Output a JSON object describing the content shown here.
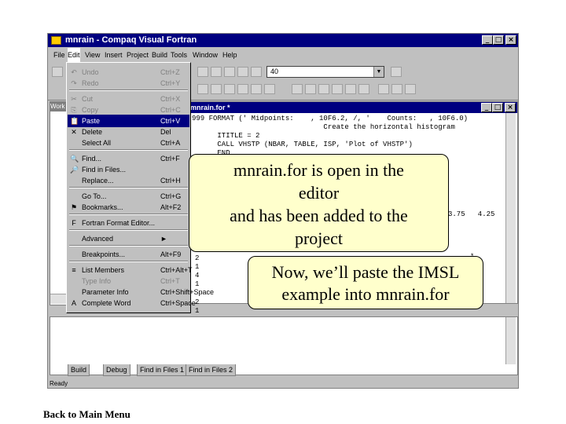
{
  "window": {
    "title": "mnrain - Compaq Visual Fortran",
    "controls": [
      "_",
      "□",
      "×"
    ]
  },
  "menubar": [
    "File",
    "Edit",
    "View",
    "Insert",
    "Project",
    "Build",
    "Tools",
    "Window",
    "Help"
  ],
  "toolbar": {
    "combo_value": "40"
  },
  "left_pane": {
    "tab_label": "Work"
  },
  "editor": {
    "title": "mnrain.for *",
    "code_lines": [
      "999 FORMAT (' Midpoints:    , 10F6.2, /, '    Counts:   , 10F6.0)",
      "                               Create the horizontal histogram",
      "      ITITLE = 2",
      "      CALL VHSTP (NBAR, TABLE, ISP, 'Plot of VHSTP')",
      "      END"
    ],
    "right_values": "3.75   4.25",
    "stars": [
      "*",
      "*",
      "*",
      "*"
    ],
    "left_digits": [
      "2",
      "1",
      "4",
      "1",
      "2",
      "1",
      "1"
    ]
  },
  "edit_menu": {
    "items": [
      {
        "icon": "↶",
        "label": "Undo",
        "shortcut": "Ctrl+Z",
        "state": "disabled"
      },
      {
        "icon": "↷",
        "label": "Redo",
        "shortcut": "Ctrl+Y",
        "state": "disabled"
      },
      {
        "sep": true
      },
      {
        "icon": "✂",
        "label": "Cut",
        "shortcut": "Ctrl+X",
        "state": "disabled"
      },
      {
        "icon": "⎘",
        "label": "Copy",
        "shortcut": "Ctrl+C",
        "state": "disabled"
      },
      {
        "icon": "📋",
        "label": "Paste",
        "shortcut": "Ctrl+V",
        "state": "selected"
      },
      {
        "icon": "✕",
        "label": "Delete",
        "shortcut": "Del",
        "state": "normal"
      },
      {
        "icon": "",
        "label": "Select All",
        "shortcut": "Ctrl+A",
        "state": "normal"
      },
      {
        "sep": true
      },
      {
        "icon": "🔍",
        "label": "Find...",
        "shortcut": "Ctrl+F",
        "state": "normal"
      },
      {
        "icon": "🔎",
        "label": "Find in Files...",
        "shortcut": "",
        "state": "normal"
      },
      {
        "icon": "",
        "label": "Replace...",
        "shortcut": "Ctrl+H",
        "state": "normal"
      },
      {
        "sep": true
      },
      {
        "icon": "",
        "label": "Go To...",
        "shortcut": "Ctrl+G",
        "state": "normal"
      },
      {
        "icon": "⚑",
        "label": "Bookmarks...",
        "shortcut": "Alt+F2",
        "state": "normal"
      },
      {
        "sep": true
      },
      {
        "icon": "F",
        "label": "Fortran Format Editor...",
        "shortcut": "",
        "state": "normal"
      },
      {
        "sep": true
      },
      {
        "icon": "",
        "label": "Advanced",
        "shortcut": "►",
        "state": "normal"
      },
      {
        "sep": true
      },
      {
        "icon": "",
        "label": "Breakpoints...",
        "shortcut": "Alt+F9",
        "state": "normal"
      },
      {
        "sep": true
      },
      {
        "icon": "≡",
        "label": "List Members",
        "shortcut": "Ctrl+Alt+T",
        "state": "normal"
      },
      {
        "icon": "",
        "label": "Type Info",
        "shortcut": "Ctrl+T",
        "state": "disabled"
      },
      {
        "icon": "",
        "label": "Parameter Info",
        "shortcut": "Ctrl+Shift+Space",
        "state": "normal"
      },
      {
        "icon": "A",
        "label": "Complete Word",
        "shortcut": "Ctrl+Space",
        "state": "normal"
      }
    ]
  },
  "output_tabs": [
    "Build",
    "Debug",
    "Find in Files 1",
    "Find in Files 2"
  ],
  "status": "Ready",
  "callouts": {
    "first": [
      "mnrain.for is open in the",
      "editor",
      "and has been added to the",
      "project"
    ],
    "second": [
      "Now, we’ll paste the IMSL",
      "example into mnrain.for"
    ]
  },
  "back_link": "Back to Main Menu"
}
